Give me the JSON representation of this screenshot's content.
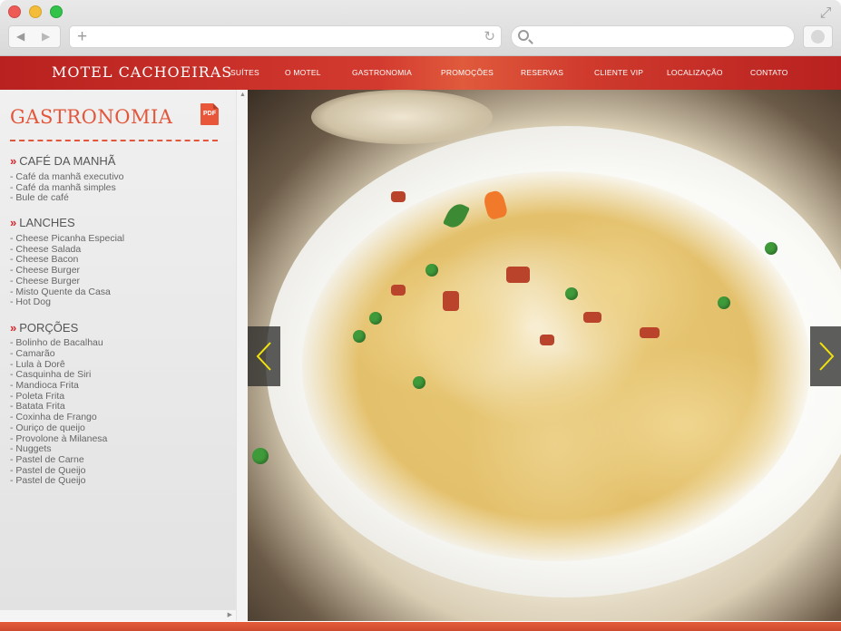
{
  "site": {
    "logo": "MOTEL CACHOEIRAS",
    "menu": [
      {
        "label": "SUÍTES"
      },
      {
        "label": "O MOTEL"
      },
      {
        "label": "GASTRONOMIA"
      },
      {
        "label": "PROMOÇÕES"
      },
      {
        "label": "RESERVAS"
      },
      {
        "label": "CLIENTE VIP"
      },
      {
        "label": "LOCALIZAÇÃO"
      },
      {
        "label": "CONTATO"
      }
    ]
  },
  "sidebar": {
    "title": "GASTRONOMIA",
    "pdf_label": "PDF",
    "section_marker": "»",
    "sections": [
      {
        "heading": "CAFÉ DA MANHÃ",
        "items": [
          "- Café da manhã executivo",
          "- Café da manhã simples",
          "- Bule de café"
        ]
      },
      {
        "heading": "LANCHES",
        "items": [
          "- Cheese Picanha Especial",
          "- Cheese Salada",
          "- Cheese Bacon",
          "- Cheese Burger",
          "- Cheese Burger",
          "- Misto Quente da Casa",
          "- Hot Dog"
        ]
      },
      {
        "heading": "PORÇÕES",
        "items": [
          "- Bolinho de Bacalhau",
          "- Camarão",
          "- Lula à Dorê",
          "- Casquinha de Siri",
          "- Mandioca Frita",
          "- Poleta Frita",
          "- Batata Frita",
          "- Coxinha de Frango",
          "- Ouriço de queijo",
          "- Provolone à Milanesa",
          "- Nuggets",
          "- Pastel de Carne",
          "- Pastel de Queijo",
          "- Pastel de Queijo"
        ]
      }
    ]
  },
  "browser": {
    "icons": [
      "back-icon",
      "forward-icon",
      "new-tab-icon",
      "reload-icon",
      "search-icon",
      "expand-icon"
    ]
  },
  "colors": {
    "accent": "#e2573b",
    "header_red": "#c52e26",
    "marker_red": "#d6272b"
  },
  "slideshow": {
    "icons": [
      "chevron-left-icon",
      "chevron-right-icon"
    ]
  }
}
